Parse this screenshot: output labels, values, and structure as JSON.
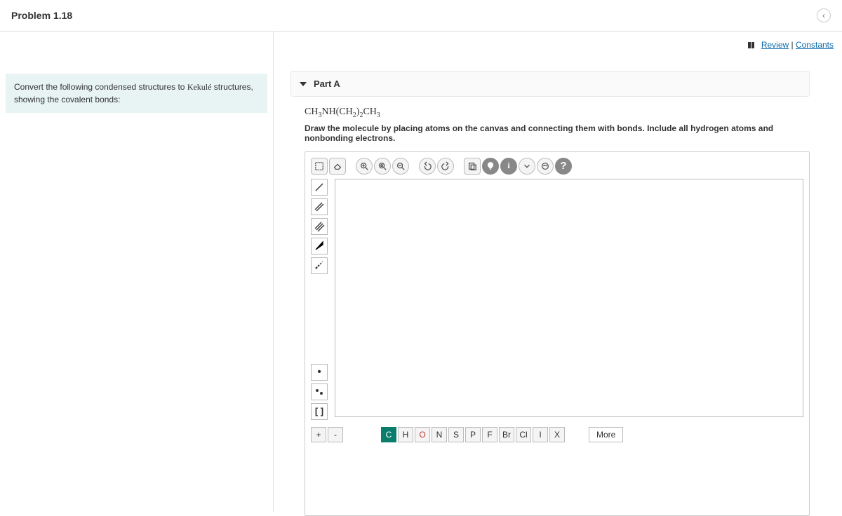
{
  "header": {
    "title": "Problem 1.18"
  },
  "top_links": {
    "review": "Review",
    "sep": " | ",
    "constants": "Constants"
  },
  "left_panel": {
    "prompt_pre": "Convert the following condensed structures to ",
    "prompt_kekule": "Kekulé",
    "prompt_post": " structures, showing the covalent bonds:"
  },
  "part": {
    "label": "Part A",
    "formula_html": "CH<sub>3</sub>NH(CH<sub>2</sub>)<sub>2</sub>CH<sub>3</sub>",
    "instruction": "Draw the molecule by placing atoms on the canvas and connecting them with bonds. Include all hydrogen atoms and nonbonding electrons."
  },
  "toolbar_top": {
    "marquee": "marquee-select",
    "eraser": "eraser",
    "zoom_in": "zoom-in",
    "zoom_fit": "zoom-fit",
    "zoom_out": "zoom-out",
    "undo": "undo",
    "redo": "redo",
    "paste": "paste",
    "hint": "hint",
    "info": "i",
    "expand": "expand",
    "view": "view",
    "help": "?"
  },
  "left_tools": {
    "single": "single-bond",
    "double": "double-bond",
    "triple": "triple-bond",
    "wedge": "wedge-bond",
    "dash": "dash-bond",
    "radical": "•",
    "lone": "lone-pair",
    "brackets": "[ ]"
  },
  "bottom": {
    "plus": "+",
    "minus": "-",
    "elements": [
      "C",
      "H",
      "O",
      "N",
      "S",
      "P",
      "F",
      "Br",
      "Cl",
      "I",
      "X"
    ],
    "selected": "C",
    "more": "More"
  }
}
